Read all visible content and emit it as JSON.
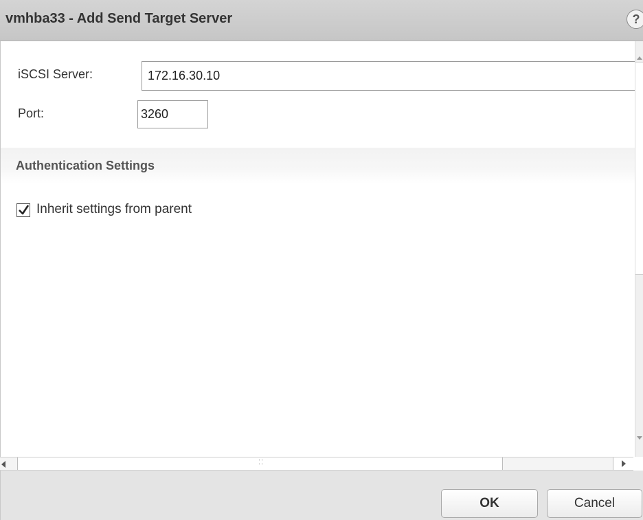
{
  "dialog": {
    "title": "vmhba33 - Add Send Target Server",
    "help_icon": "help-icon",
    "help_glyph": "?"
  },
  "form": {
    "server_label": "iSCSI Server:",
    "server_value": "172.16.30.10",
    "port_label": "Port:",
    "port_value": "3260"
  },
  "auth": {
    "section_title": "Authentication Settings",
    "inherit_label": "Inherit settings from parent",
    "inherit_checked": true
  },
  "scrollbars": {
    "grip_glyph": "⁚⁚"
  },
  "buttons": {
    "ok": "OK",
    "cancel": "Cancel"
  }
}
